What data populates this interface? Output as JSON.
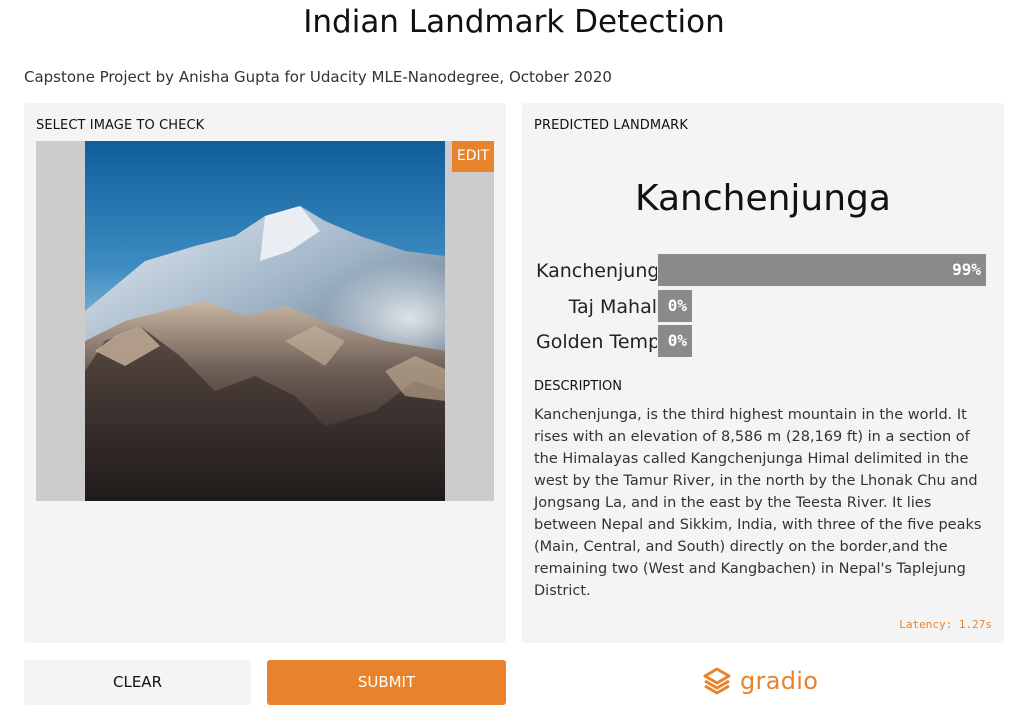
{
  "header": {
    "title": "Indian Landmark Detection",
    "subtitle": "Capstone Project by Anisha Gupta for Udacity MLE-Nanodegree, October 2020"
  },
  "input_panel": {
    "label": "SELECT IMAGE TO CHECK",
    "edit_label": "EDIT"
  },
  "output_panel": {
    "label": "PREDICTED LANDMARK",
    "predicted_landmark": "Kanchenjunga",
    "predictions": [
      {
        "name": "Kanchenjunga",
        "percent_label": "99%",
        "confidence": 0.99
      },
      {
        "name": "Taj Mahal",
        "percent_label": "0%",
        "confidence": 0.0
      },
      {
        "name": "Golden Temple",
        "percent_label": "0%",
        "confidence": 0.0
      }
    ],
    "description_label": "DESCRIPTION",
    "description": "Kanchenjunga, is the third highest mountain in the world. It rises with an elevation of 8,586 m (28,169 ft) in a section of the Himalayas called Kangchenjunga Himal delimited in the west by the Tamur River, in the north by the Lhonak Chu and Jongsang La, and in the east by the Teesta River. It lies between Nepal and Sikkim, India, with three of the five peaks (Main, Central, and South) directly on the border,and the remaining two (West and Kangbachen) in Nepal's Taplejung District.",
    "latency": "Latency: 1.27s"
  },
  "actions": {
    "clear_label": "CLEAR",
    "submit_label": "SUBMIT"
  },
  "footer": {
    "brand": "gradio"
  },
  "colors": {
    "accent": "#e8832c",
    "panel_bg": "#f4f4f4",
    "bar_fill": "#8a8a8a",
    "image_bg": "#cccccc"
  }
}
